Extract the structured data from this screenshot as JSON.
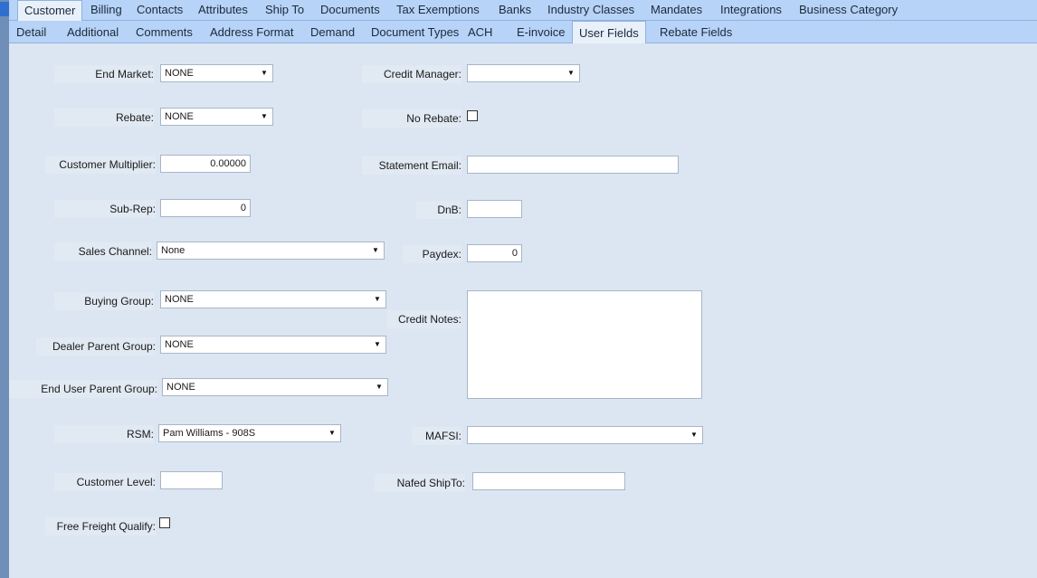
{
  "tabs_top": [
    "Customer",
    "Billing",
    "Contacts",
    "Attributes",
    "Ship To",
    "Documents",
    "Tax Exemptions",
    "Banks",
    "Industry Classes",
    "Mandates",
    "Integrations",
    "Business Category"
  ],
  "tabs_sub": [
    "Detail",
    "Additional",
    "Comments",
    "Address Format",
    "Demand",
    "Document Types",
    "ACH",
    "E-invoice",
    "User Fields",
    "Rebate Fields"
  ],
  "active_top": "Customer",
  "active_sub": "User Fields",
  "fields": {
    "end_market": {
      "label": "End Market:",
      "value": "NONE"
    },
    "rebate": {
      "label": "Rebate:",
      "value": "NONE"
    },
    "customer_multiplier": {
      "label": "Customer Multiplier:",
      "value": "0.00000"
    },
    "sub_rep": {
      "label": "Sub-Rep:",
      "value": "0"
    },
    "sales_channel": {
      "label": "Sales Channel:",
      "value": "None"
    },
    "buying_group": {
      "label": "Buying Group:",
      "value": "NONE"
    },
    "dealer_parent_group": {
      "label": "Dealer Parent Group:",
      "value": "NONE"
    },
    "end_user_parent_group": {
      "label": "End User Parent Group:",
      "value": "NONE"
    },
    "rsm": {
      "label": "RSM:",
      "value": "Pam Williams - 908S"
    },
    "customer_level": {
      "label": "Customer Level:",
      "value": ""
    },
    "free_freight_qualify": {
      "label": "Free Freight Qualify:"
    },
    "credit_manager": {
      "label": "Credit Manager:",
      "value": ""
    },
    "no_rebate": {
      "label": "No Rebate:"
    },
    "statement_email": {
      "label": "Statement Email:",
      "value": ""
    },
    "dnb": {
      "label": "DnB:",
      "value": ""
    },
    "paydex": {
      "label": "Paydex:",
      "value": "0"
    },
    "credit_notes": {
      "label": "Credit Notes:"
    },
    "mafsi": {
      "label": "MAFSI:",
      "value": ""
    },
    "nafed_shipto": {
      "label": "Nafed ShipTo:",
      "value": ""
    }
  },
  "icons": {
    "dropdown": "chevron-down-icon"
  },
  "colors": {
    "tab_bar": "#b7d3f7",
    "panel": "#dce6f2",
    "active_tab": "#e8f0fa"
  }
}
